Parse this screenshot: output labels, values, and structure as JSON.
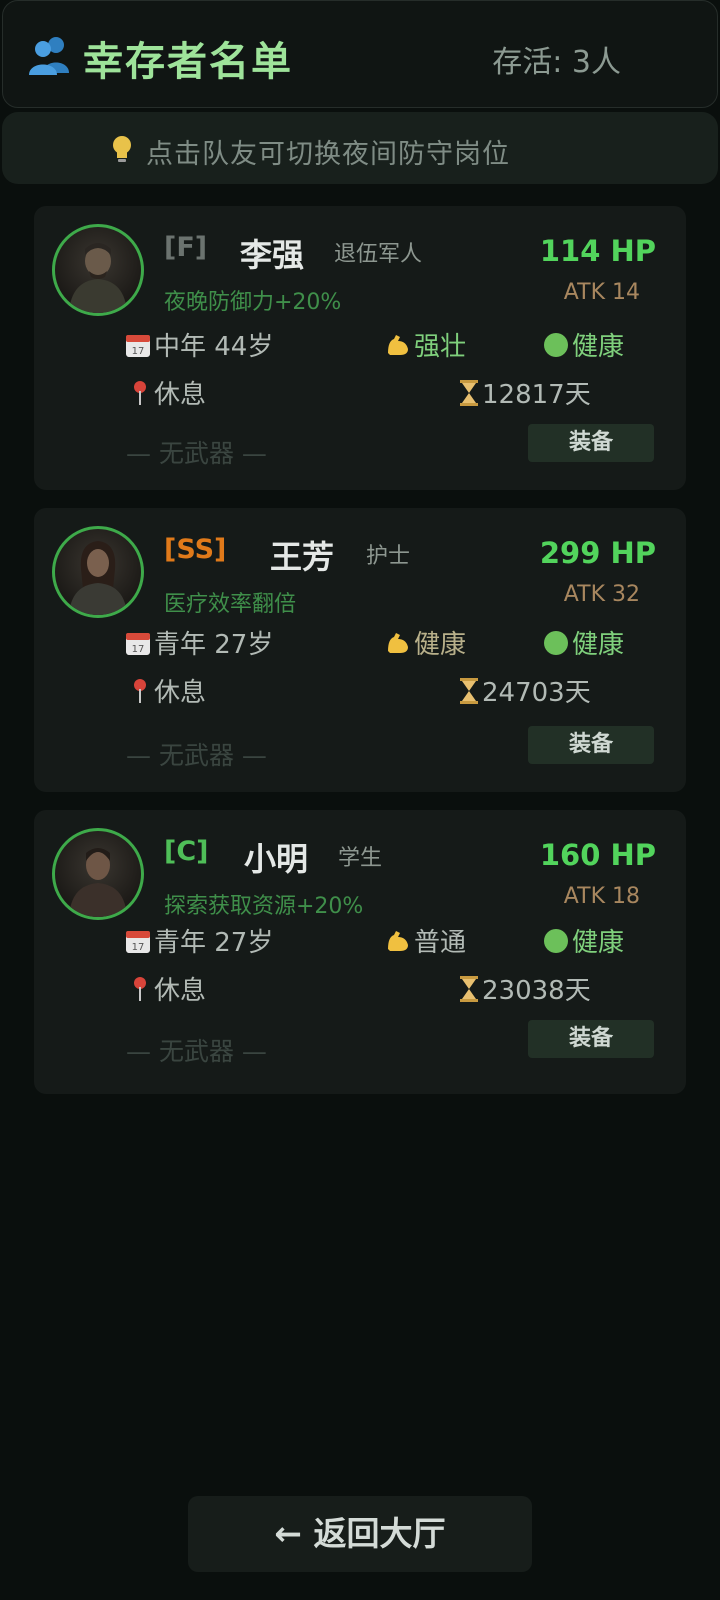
{
  "header": {
    "title": "幸存者名单",
    "count_text": "存活: 3人"
  },
  "hint": {
    "text": "点击队友可切换夜间防守岗位"
  },
  "survivors": [
    {
      "rank": "[F]",
      "rank_color": "#6b736f",
      "name": "李强",
      "job": "退伍军人",
      "hp": "114 HP",
      "atk": "ATK 14",
      "trait": "夜晚防御力+20%",
      "age": "中年 44岁",
      "body": "强壮",
      "health": "健康",
      "location": "休息",
      "days": "12817天",
      "weapon": "— 无武器 —",
      "equip": "装备"
    },
    {
      "rank": "[SS]",
      "rank_color": "#e07a1a",
      "name": "王芳",
      "job": "护士",
      "hp": "299 HP",
      "atk": "ATK 32",
      "trait": "医疗效率翻倍",
      "age": "青年 27岁",
      "body": "健康",
      "health": "健康",
      "location": "休息",
      "days": "24703天",
      "weapon": "— 无武器 —",
      "equip": "装备"
    },
    {
      "rank": "[C]",
      "rank_color": "#4fbf58",
      "name": "小明",
      "job": "学生",
      "hp": "160 HP",
      "atk": "ATK 18",
      "trait": "探索获取资源+20%",
      "age": "青年 27岁",
      "body": "普通",
      "health": "健康",
      "location": "休息",
      "days": "23038天",
      "weapon": "— 无武器 —",
      "equip": "装备"
    }
  ],
  "footer": {
    "back_label": "← 返回大厅"
  },
  "colors": {
    "accent_green": "#52d45c",
    "title_green": "#9ee39a",
    "atk_brown": "#a8875f"
  }
}
